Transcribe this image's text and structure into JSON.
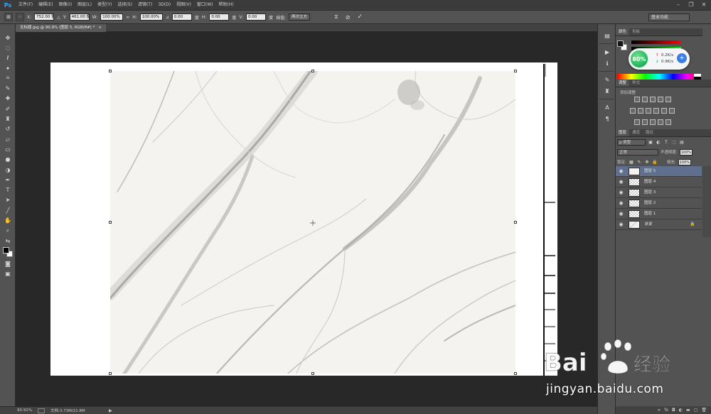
{
  "app": {
    "logo": "Ps"
  },
  "menu": [
    "文件(F)",
    "编辑(E)",
    "图像(I)",
    "图层(L)",
    "类型(Y)",
    "选择(S)",
    "滤镜(T)",
    "3D(D)",
    "视图(V)",
    "窗口(W)",
    "帮助(H)"
  ],
  "options": {
    "x_label": "X:",
    "x_value": "752.00 像",
    "y_label": "Y:",
    "y_value": "461.00 像",
    "w_label": "W:",
    "w_value": "100.00%",
    "h_label": "H:",
    "h_value": "100.00%",
    "angle_value": "0.00",
    "angle_unit": "度",
    "hskew_label": "H:",
    "hskew_value": "0.00",
    "hskew_unit": "度",
    "vskew_label": "V:",
    "vskew_value": "0.00",
    "vskew_unit": "度",
    "interp_label": "插值:",
    "interp_value": "两次立方",
    "workspace": "基本功能"
  },
  "document": {
    "tab": "无标题.jpg @ 90.9% (图层 5, RGB/8#) *"
  },
  "status": {
    "zoom": "90.91%",
    "doc_info": "文档:3.73M/21.8M"
  },
  "color_panel": {
    "tabs": [
      "颜色",
      "色板"
    ],
    "fg_color": "#141414",
    "bg_color": "#ffffff"
  },
  "net_widget": {
    "percent": "80%",
    "upload": "0.2K/s",
    "download": "0.9K/s"
  },
  "adjust_panel": {
    "tabs": [
      "调整",
      "样式"
    ],
    "add_label": "添加调整"
  },
  "layers_panel": {
    "tabs": [
      "图层",
      "通道",
      "路径"
    ],
    "kind_filter": "ρ 类型",
    "blend_mode": "正常",
    "opacity_label": "不透明度:",
    "opacity_value": "100%",
    "lock_label": "锁定:",
    "fill_label": "填充:",
    "fill_value": "100%",
    "layers": [
      {
        "name": "图层 5",
        "selected": true,
        "thumb": "white"
      },
      {
        "name": "图层 4",
        "selected": false,
        "thumb": "checker"
      },
      {
        "name": "图层 3",
        "selected": false,
        "thumb": "checker"
      },
      {
        "name": "图层 2",
        "selected": false,
        "thumb": "checker"
      },
      {
        "name": "图层 1",
        "selected": false,
        "thumb": "checker"
      },
      {
        "name": "背景",
        "selected": false,
        "thumb": "marble",
        "locked": true
      }
    ]
  },
  "watermark": {
    "url": "jingyan.baidu.com",
    "brand": "Bai",
    "brand2": "经验"
  }
}
